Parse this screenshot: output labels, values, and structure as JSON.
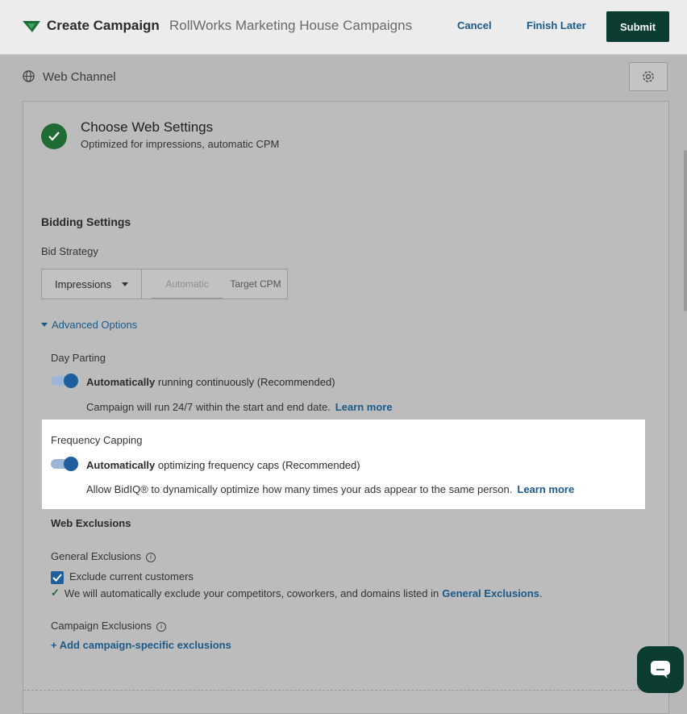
{
  "header": {
    "app_title": "Create Campaign",
    "org_name": "RollWorks Marketing House Campaigns",
    "cancel_label": "Cancel",
    "finish_later_label": "Finish Later",
    "submit_label": "Submit",
    "brand_color": "#0a3c32"
  },
  "channel": {
    "title": "Web Channel",
    "icon": "globe-icon",
    "settings_icon": "gear-icon"
  },
  "web_settings": {
    "title": "Choose Web Settings",
    "subtitle": "Optimized for impressions, automatic CPM",
    "status_icon": "check-circle-icon"
  },
  "bidding": {
    "title": "Bidding Settings",
    "strategy_label": "Bid Strategy",
    "strategy_value": "Impressions",
    "option_automatic": "Automatic",
    "option_target": "Target CPM"
  },
  "advanced": {
    "toggle_label": "Advanced Options",
    "day_parting": {
      "label": "Day Parting",
      "toggle_on": true,
      "toggle_bold": "Automatically",
      "toggle_rest": " running continuously (Recommended)",
      "description": "Campaign will run 24/7 within the start and end date.",
      "learn_more": "Learn more"
    },
    "frequency_capping": {
      "label": "Frequency Capping",
      "toggle_on": true,
      "toggle_bold": "Automatically",
      "toggle_rest": " optimizing frequency caps (Recommended)",
      "description": "Allow BidIQ® to dynamically optimize how many times your ads appear to the same person.",
      "learn_more": "Learn more"
    }
  },
  "exclusions": {
    "title": "Web Exclusions",
    "general_label": "General Exclusions",
    "exclude_customers_label": "Exclude current customers",
    "exclude_customers_checked": true,
    "note_text": "We will automatically exclude your competitors, coworkers, and domains listed in",
    "note_link": "General Exclusions",
    "note_end": ".",
    "campaign_label": "Campaign Exclusions",
    "add_link": "+ Add campaign-specific exclusions"
  },
  "chat": {
    "icon": "chat-icon"
  }
}
